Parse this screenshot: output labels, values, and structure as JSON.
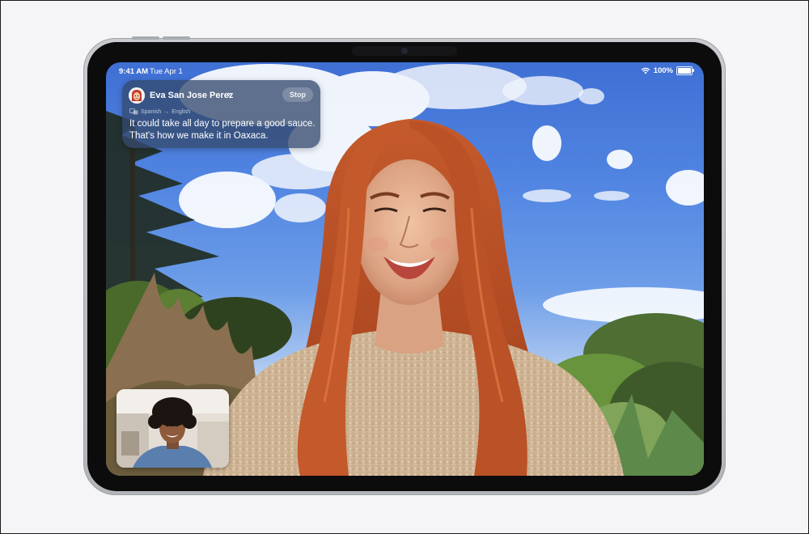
{
  "status_bar": {
    "time": "9:41 AM",
    "date": "Tue Apr 1",
    "battery": "100%",
    "battery_level": 1.0
  },
  "caption": {
    "caller_name": "Eva San Jose Perez",
    "chevron": "›",
    "stop_label": "Stop",
    "source_language": "Spanish",
    "arrow": "→",
    "target_language": "English",
    "translated_text": "It could take all day to prepare a good sauce. That's how we make it in Oaxaca."
  },
  "icons": {
    "wifi": "wifi-icon",
    "battery": "battery-icon",
    "translate": "translate-icon",
    "avatar": "memoji-avatar-icon"
  },
  "colors": {
    "caption_background": "#344a6e",
    "bezel": "#0c0c0d",
    "device_frame": "#c2c5ca",
    "sky": "#4a7ddc"
  }
}
